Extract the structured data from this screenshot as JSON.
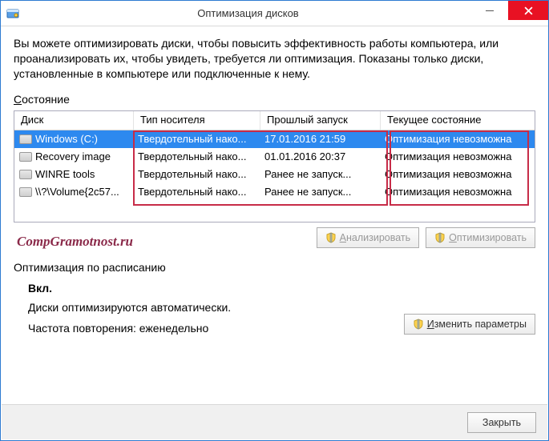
{
  "titlebar": {
    "title": "Оптимизация дисков"
  },
  "description": "Вы можете оптимизировать диски, чтобы повысить эффективность работы  компьютера, или проанализировать их, чтобы увидеть, требуется ли оптимизация. Показаны только диски, установленные в компьютере или подключенные к нему.",
  "status_label": "Состояние",
  "columns": {
    "c0": "Диск",
    "c1": "Тип носителя",
    "c2": "Прошлый запуск",
    "c3": "Текущее состояние"
  },
  "rows": [
    {
      "name": "Windows (C:)",
      "media": "Твердотельный нако...",
      "last": "17.01.2016 21:59",
      "state": "Оптимизация невозможна",
      "selected": true
    },
    {
      "name": "Recovery image",
      "media": "Твердотельный нако...",
      "last": "01.01.2016 20:37",
      "state": "Оптимизация невозможна",
      "selected": false
    },
    {
      "name": "WINRE tools",
      "media": "Твердотельный нако...",
      "last": "Ранее не запуск...",
      "state": "Оптимизация невозможна",
      "selected": false
    },
    {
      "name": "\\\\?\\Volume{2c57...",
      "media": "Твердотельный нако...",
      "last": "Ранее не запуск...",
      "state": "Оптимизация невозможна",
      "selected": false
    }
  ],
  "watermark": "CompGramotnost.ru",
  "buttons": {
    "analyze": "Анализировать",
    "optimize": "Оптимизировать",
    "change": "Изменить параметры",
    "close": "Закрыть"
  },
  "schedule": {
    "title": "Оптимизация по расписанию",
    "on": "Вкл.",
    "auto": "Диски оптимизируются автоматически.",
    "freq": "Частота повторения: еженедельно"
  }
}
